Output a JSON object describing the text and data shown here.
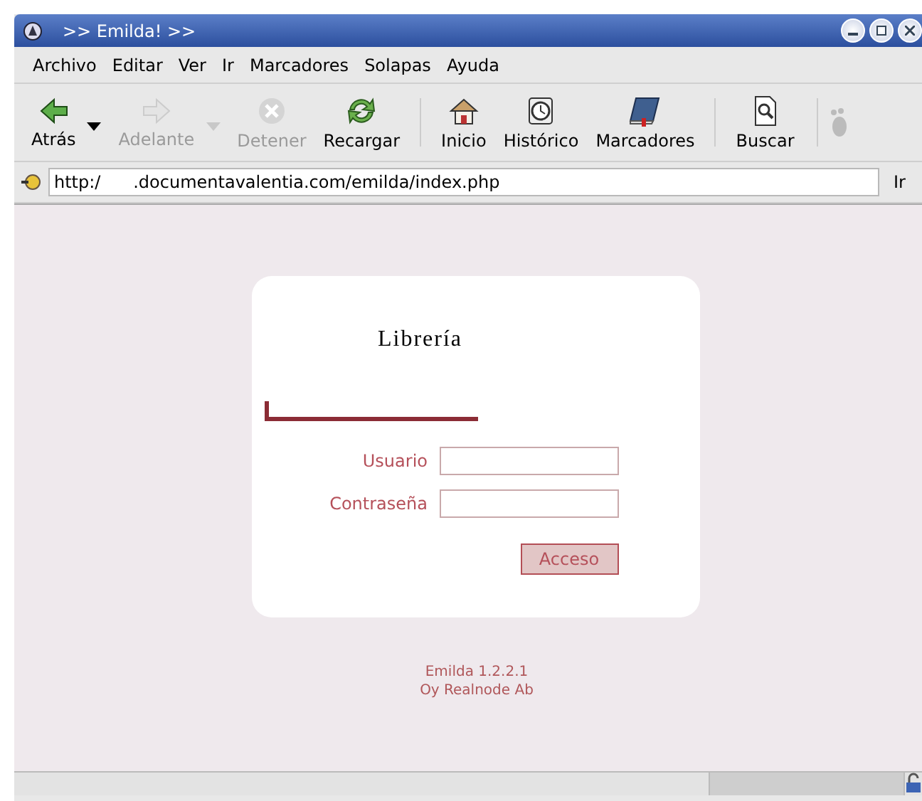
{
  "window": {
    "title": ">> Emilda! >>"
  },
  "menu": [
    {
      "label": "Archivo"
    },
    {
      "label": "Editar"
    },
    {
      "label": "Ver"
    },
    {
      "label": "Ir"
    },
    {
      "label": "Marcadores"
    },
    {
      "label": "Solapas"
    },
    {
      "label": "Ayuda"
    }
  ],
  "toolbar": [
    {
      "label": "Atrás",
      "disabled": false,
      "dropdown": true
    },
    {
      "label": "Adelante",
      "disabled": true,
      "dropdown": true
    },
    {
      "label": "Detener",
      "disabled": true,
      "dropdown": false
    },
    {
      "label": "Recargar",
      "disabled": false,
      "dropdown": false
    },
    {
      "label": "Inicio",
      "disabled": false,
      "dropdown": false
    },
    {
      "label": "Histórico",
      "disabled": false,
      "dropdown": false
    },
    {
      "label": "Marcadores",
      "disabled": false,
      "dropdown": false
    },
    {
      "label": "Buscar",
      "disabled": false,
      "dropdown": false
    }
  ],
  "address_bar": {
    "value": "http:/      .documentavalentia.com/emilda/index.php",
    "go_button": "Ir"
  },
  "login": {
    "title": "Librería",
    "fields": [
      {
        "label": "Usuario"
      },
      {
        "label": "Contraseña"
      }
    ],
    "submit": "Acceso"
  },
  "footer": [
    "Emilda 1.2.2.1",
    "Oy Realnode Ab"
  ]
}
